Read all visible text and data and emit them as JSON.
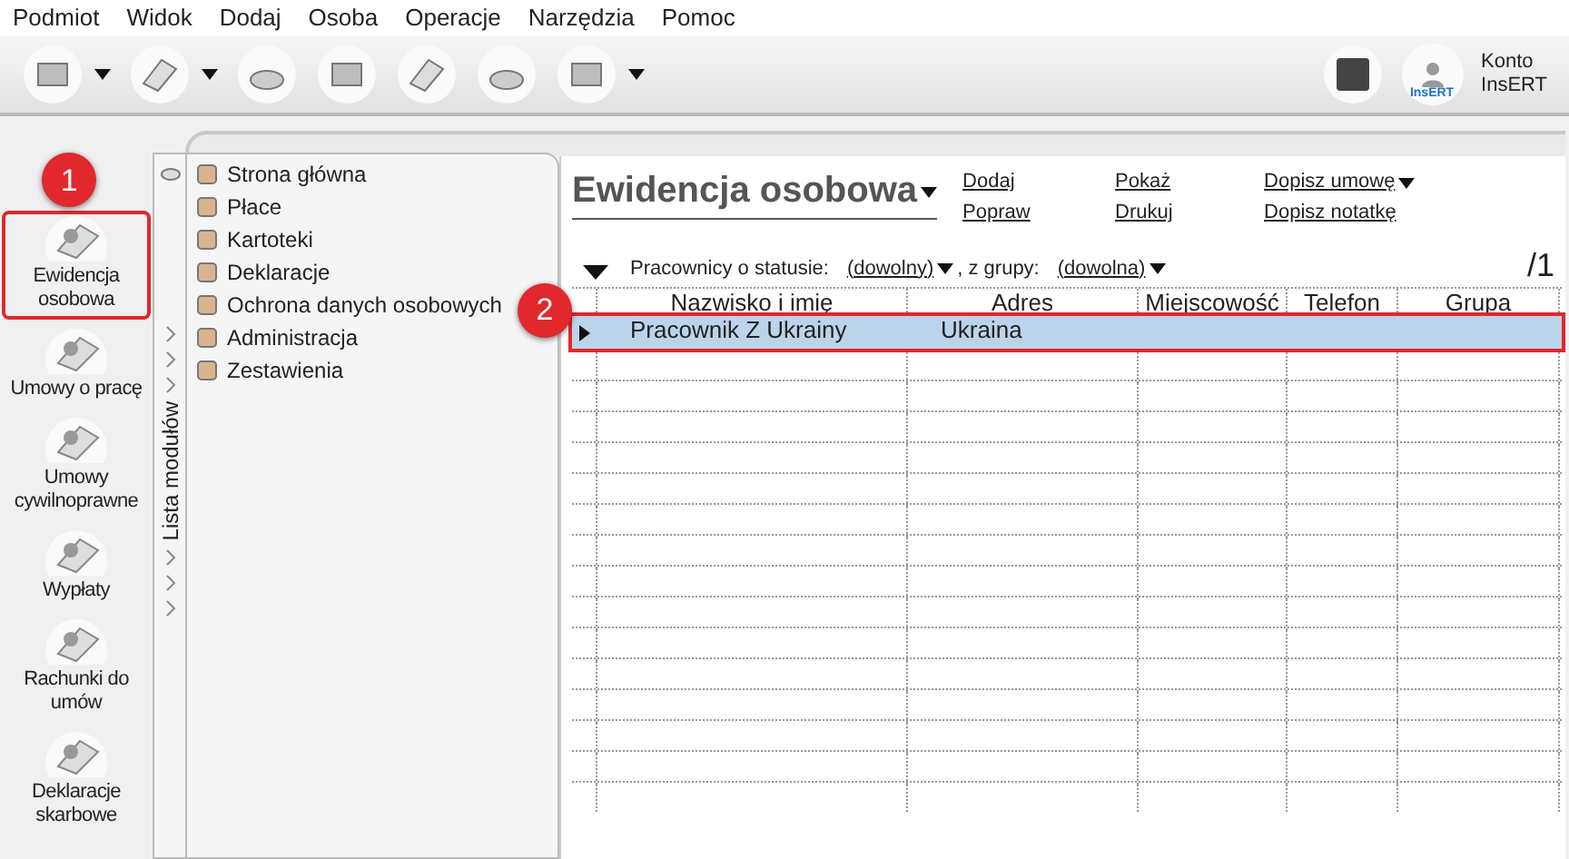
{
  "menu": [
    "Podmiot",
    "Widok",
    "Dodaj",
    "Osoba",
    "Operacje",
    "Narzędzia",
    "Pomoc"
  ],
  "account": {
    "line1": "Konto",
    "line2": "InsERT",
    "logo": "InsERT"
  },
  "sidebar": {
    "items": [
      {
        "label": "Ewidencja osobowa",
        "highlighted": true,
        "badge": "1"
      },
      {
        "label": "Umowy o pracę",
        "highlighted": false
      },
      {
        "label": "Umowy cywilnoprawne",
        "highlighted": false
      },
      {
        "label": "Wypłaty",
        "highlighted": false
      },
      {
        "label": "Rachunki do umów",
        "highlighted": false
      },
      {
        "label": "Deklaracje skarbowe",
        "highlighted": false
      }
    ]
  },
  "module_list": {
    "title": "Lista modułów",
    "items": [
      "Strona główna",
      "Płace",
      "Kartoteki",
      "Deklaracje",
      "Ochrona danych osobowych",
      "Administracja",
      "Zestawienia"
    ]
  },
  "main": {
    "title": "Ewidencja osobowa",
    "actions": [
      [
        "Dodaj",
        "Popraw"
      ],
      [
        "Pokaż",
        "Drukuj"
      ],
      [
        "Dopisz umowę",
        "Dopisz notatkę"
      ]
    ],
    "filter": {
      "status_label": "Pracownicy o statusie:",
      "status_value": "(dowolny)",
      "group_label": ", z grupy:",
      "group_value": "(dowolna)",
      "page": "/1"
    },
    "table": {
      "badge": "2",
      "columns": [
        "Nazwisko i imię",
        "Adres",
        "Miejscowość",
        "Telefon",
        "Grupa"
      ],
      "rows": [
        {
          "cells": [
            "Pracownik Z Ukrainy",
            "Ukraina",
            "",
            "",
            ""
          ],
          "selected": true,
          "highlighted": true
        }
      ]
    }
  }
}
